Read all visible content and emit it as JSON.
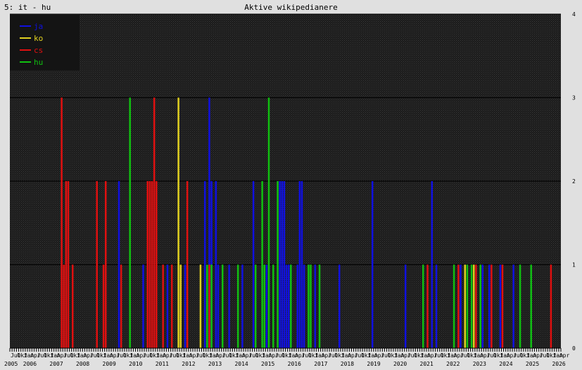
{
  "header": {
    "corner_label": "5: it - hu",
    "title": "Aktive wikipedianere"
  },
  "colors": {
    "background": "#e0e0e0",
    "plot_bg": "#1a1a1a",
    "grid": "#000000",
    "axis": "#000000",
    "ja": "#1010e0",
    "ko": "#e0d020",
    "cs": "#e01010",
    "hu": "#10c010"
  },
  "chart_data": {
    "type": "bar",
    "title": "Aktive wikipedianere",
    "x_axis": {
      "start": "2005-07",
      "end": "2026-05",
      "unit": "month"
    },
    "ylim": [
      0,
      4
    ],
    "yticks": [
      0,
      1,
      2,
      3,
      4
    ],
    "y_axis_side": "right",
    "grid": true,
    "legend_position": "top-left",
    "month_tick_labels": [
      "Jul",
      "Okt",
      "Jan",
      "Apr"
    ],
    "year_labels": [
      "2005",
      "2006",
      "2007",
      "2008",
      "2009",
      "2010",
      "2011",
      "2012",
      "2013",
      "2014",
      "2015",
      "2016",
      "2017",
      "2018",
      "2019",
      "2020",
      "2021",
      "2022",
      "2023",
      "2024",
      "2025",
      "2026"
    ],
    "series": [
      {
        "name": "ja",
        "color": "#1010e0",
        "points": [
          [
            "2009-08",
            2
          ],
          [
            "2010-07",
            1
          ],
          [
            "2011-06",
            1
          ],
          [
            "2012-02",
            1
          ],
          [
            "2012-11",
            2
          ],
          [
            "2013-01",
            3
          ],
          [
            "2013-02",
            2
          ],
          [
            "2013-04",
            2
          ],
          [
            "2013-05",
            1
          ],
          [
            "2013-10",
            1
          ],
          [
            "2014-04",
            1
          ],
          [
            "2014-09",
            2
          ],
          [
            "2015-03",
            1
          ],
          [
            "2015-09",
            2
          ],
          [
            "2015-10",
            2
          ],
          [
            "2015-11",
            2
          ],
          [
            "2015-12",
            1
          ],
          [
            "2016-01",
            1
          ],
          [
            "2016-02",
            1
          ],
          [
            "2016-05",
            1
          ],
          [
            "2016-06",
            2
          ],
          [
            "2016-07",
            2
          ],
          [
            "2016-08",
            1
          ],
          [
            "2017-01",
            1
          ],
          [
            "2017-12",
            1
          ],
          [
            "2019-03",
            2
          ],
          [
            "2020-06",
            1
          ],
          [
            "2021-06",
            2
          ],
          [
            "2021-08",
            1
          ],
          [
            "2022-07",
            1
          ],
          [
            "2023-05",
            1
          ],
          [
            "2023-08",
            1
          ],
          [
            "2024-01",
            1
          ],
          [
            "2024-07",
            1
          ],
          [
            "2025-03",
            1
          ]
        ]
      },
      {
        "name": "ko",
        "color": "#e0d020",
        "points": [
          [
            "2011-11",
            3
          ],
          [
            "2011-12",
            1
          ],
          [
            "2012-09",
            1
          ],
          [
            "2022-09",
            1
          ],
          [
            "2023-01",
            1
          ]
        ]
      },
      {
        "name": "cs",
        "color": "#e01010",
        "points": [
          [
            "2007-06",
            3
          ],
          [
            "2007-07",
            1
          ],
          [
            "2007-08",
            2
          ],
          [
            "2007-09",
            2
          ],
          [
            "2007-11",
            1
          ],
          [
            "2008-10",
            2
          ],
          [
            "2009-01",
            1
          ],
          [
            "2009-02",
            2
          ],
          [
            "2009-09",
            1
          ],
          [
            "2010-09",
            2
          ],
          [
            "2010-10",
            2
          ],
          [
            "2010-11",
            2
          ],
          [
            "2010-12",
            3
          ],
          [
            "2011-01",
            2
          ],
          [
            "2011-04",
            1
          ],
          [
            "2011-08",
            1
          ],
          [
            "2012-03",
            2
          ],
          [
            "2013-01",
            1
          ],
          [
            "2021-04",
            1
          ],
          [
            "2022-06",
            1
          ],
          [
            "2023-02",
            1
          ],
          [
            "2023-09",
            1
          ],
          [
            "2024-02",
            1
          ],
          [
            "2025-12",
            1
          ]
        ]
      },
      {
        "name": "hu",
        "color": "#10c010",
        "points": [
          [
            "2010-01",
            3
          ],
          [
            "2012-12",
            1
          ],
          [
            "2013-02",
            1
          ],
          [
            "2013-07",
            1
          ],
          [
            "2014-02",
            1
          ],
          [
            "2014-10",
            1
          ],
          [
            "2015-01",
            2
          ],
          [
            "2015-02",
            1
          ],
          [
            "2015-04",
            3
          ],
          [
            "2015-06",
            1
          ],
          [
            "2015-08",
            2
          ],
          [
            "2016-02",
            1
          ],
          [
            "2016-10",
            1
          ],
          [
            "2016-11",
            1
          ],
          [
            "2017-03",
            1
          ],
          [
            "2021-02",
            1
          ],
          [
            "2022-04",
            1
          ],
          [
            "2022-10",
            1
          ],
          [
            "2022-12",
            1
          ],
          [
            "2023-04",
            1
          ],
          [
            "2024-10",
            1
          ],
          [
            "2025-03",
            1
          ]
        ]
      }
    ]
  }
}
